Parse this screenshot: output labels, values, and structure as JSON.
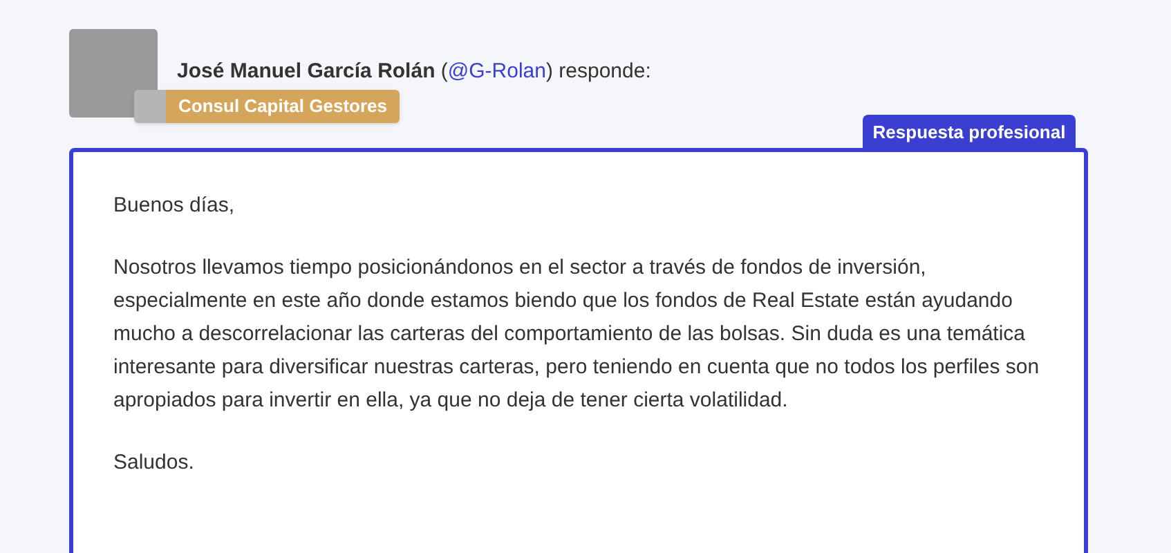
{
  "author": {
    "line": [
      {
        "kind": "name",
        "text": "José Manuel García Rolán"
      },
      {
        "kind": "plain",
        "text": " ("
      },
      {
        "kind": "link",
        "text": "@G-Rolan"
      },
      {
        "kind": "plain",
        "text": ") responde:"
      }
    ],
    "company": "Consul Capital Gestores"
  },
  "answer": {
    "tab": "Respuesta profesional",
    "paragraphs": [
      "Buenos días,",
      "Nosotros llevamos tiempo posicionándonos en el sector a través de fondos de inversión, especialmente en este año donde estamos biendo que los fondos de Real Estate están ayudando mucho a descorrelacionar las carteras del comportamiento de las bolsas. Sin duda es una temática interesante para diversificar nuestras carteras, pero teniendo en cuenta que no todos los perfiles son apropiados para invertir en ella, ya que no deja de tener cierta volatilidad.",
      "Saludos."
    ]
  }
}
